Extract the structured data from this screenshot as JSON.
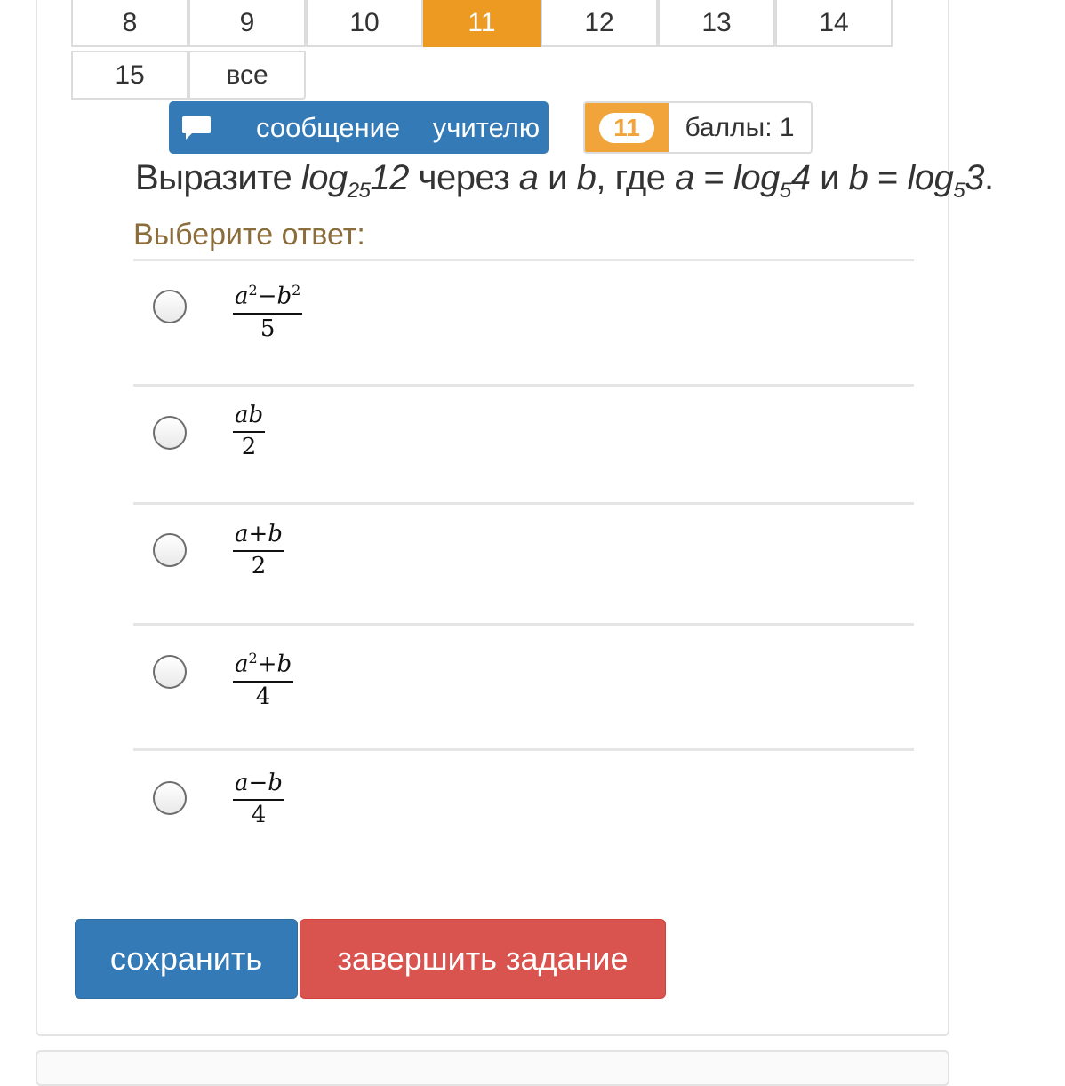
{
  "pagination": {
    "row1": [
      "8",
      "9",
      "10",
      "11",
      "12",
      "13",
      "14"
    ],
    "row2": [
      "15",
      "все"
    ],
    "active": "11"
  },
  "message_button": {
    "label": "сообщение учителю",
    "icon": "chat-bubble-icon"
  },
  "score": {
    "task_number": "11",
    "points_label": "баллы: 1"
  },
  "question": {
    "prefix": "Выразите",
    "log1_base": "25",
    "log1_arg": "12",
    "through": "через",
    "a": "a",
    "and": "и",
    "b": "b",
    "where": ", где",
    "a2": "a",
    "eq": "=",
    "log2_base": "5",
    "log2_arg": "4",
    "and2": "и",
    "b2": "b",
    "eq2": "=",
    "log3_base": "5",
    "log3_arg": "3",
    "log_word": "log"
  },
  "choose_label": "Выберите ответ:",
  "options": [
    {
      "numerator_html": "a2−b2",
      "denominator": "5"
    },
    {
      "numerator_html": "ab",
      "denominator": "2"
    },
    {
      "numerator_html": "a+b",
      "denominator": "2"
    },
    {
      "numerator_html": "a2+b",
      "denominator": "4"
    },
    {
      "numerator_html": "a−b",
      "denominator": "4"
    }
  ],
  "buttons": {
    "save": "сохранить",
    "finish": "завершить задание"
  },
  "colors": {
    "active_page": "#ec9a22",
    "primary": "#337ab7",
    "danger": "#d9534f",
    "choose_label": "#8a6d3b"
  }
}
